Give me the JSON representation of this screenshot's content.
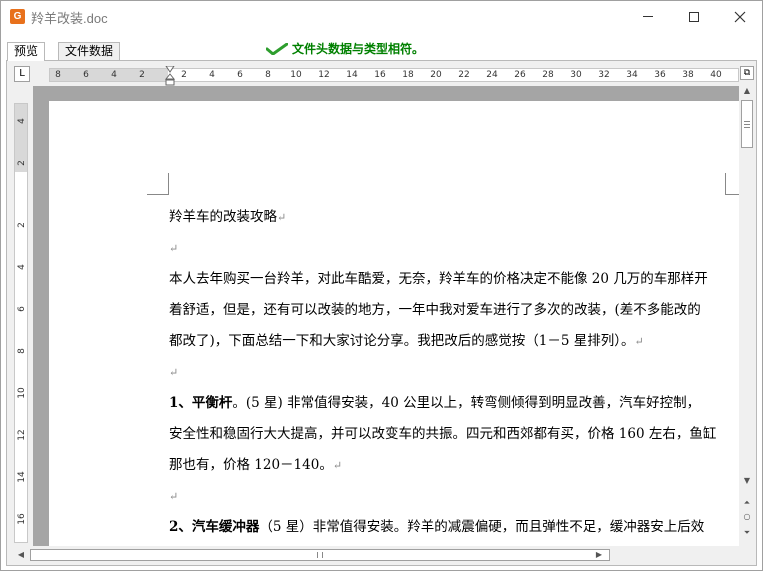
{
  "window": {
    "title": "羚羊改装.doc",
    "icon": "wps-writer-icon",
    "icon_glyph": "G"
  },
  "tabs": [
    {
      "label": "预览",
      "active": true
    },
    {
      "label": "文件数据",
      "active": false
    }
  ],
  "status": {
    "message": "文件头数据与类型相符。",
    "icon": "green-check-icon",
    "color": "#008000"
  },
  "ruler": {
    "corner_glyph": "L",
    "h_numbers": [
      "8",
      "6",
      "4",
      "2",
      "2",
      "4",
      "6",
      "8",
      "10",
      "12",
      "14",
      "16",
      "18",
      "20",
      "22",
      "24",
      "26",
      "28",
      "30",
      "32",
      "34",
      "36",
      "38",
      "40"
    ],
    "v_numbers": [
      "4",
      "2",
      "2",
      "4",
      "6",
      "8",
      "10",
      "12",
      "14",
      "16"
    ]
  },
  "document": {
    "paragraphs": [
      {
        "segments": [
          {
            "text": "羚羊车的改装攻略"
          }
        ],
        "mark": "↵"
      },
      {
        "segments": [],
        "mark": "↵"
      },
      {
        "segments": [
          {
            "text": "本人去年购买一台羚羊，对此车酷爱，无奈，羚羊车的价格决定不能像 20 几万的车那样开"
          }
        ],
        "mark": ""
      },
      {
        "segments": [
          {
            "text": "着舒适，但是，还有可以改装的地方，一年中我对爱车进行了多次的改装，(差不多能改的"
          }
        ],
        "mark": ""
      },
      {
        "segments": [
          {
            "text": "都改了)，下面总结一下和大家讨论分享。我把改后的感觉按（1－5 星排列）。"
          }
        ],
        "mark": "↵"
      },
      {
        "segments": [],
        "mark": "↵"
      },
      {
        "segments": [
          {
            "text": "1、平衡杆",
            "bold": true
          },
          {
            "text": "。(5 星)  非常值得安装，40 公里以上，转弯侧倾得到明显改善，汽车好控制，"
          }
        ],
        "mark": ""
      },
      {
        "segments": [
          {
            "text": "安全性和稳固行大大提高，并可以改变车的共振。四元和西郊都有买，价格 160 左右，鱼缸"
          }
        ],
        "mark": ""
      },
      {
        "segments": [
          {
            "text": "那也有，价格 120－140。"
          }
        ],
        "mark": "↵"
      },
      {
        "segments": [],
        "mark": "↵"
      },
      {
        "segments": [
          {
            "text": "2、汽车缓冲器",
            "bold": true
          },
          {
            "text": "（5 星）非常值得安装。羚羊的减震偏硬，而且弹性不足，缓冲器安上后效"
          }
        ],
        "mark": ""
      }
    ]
  }
}
